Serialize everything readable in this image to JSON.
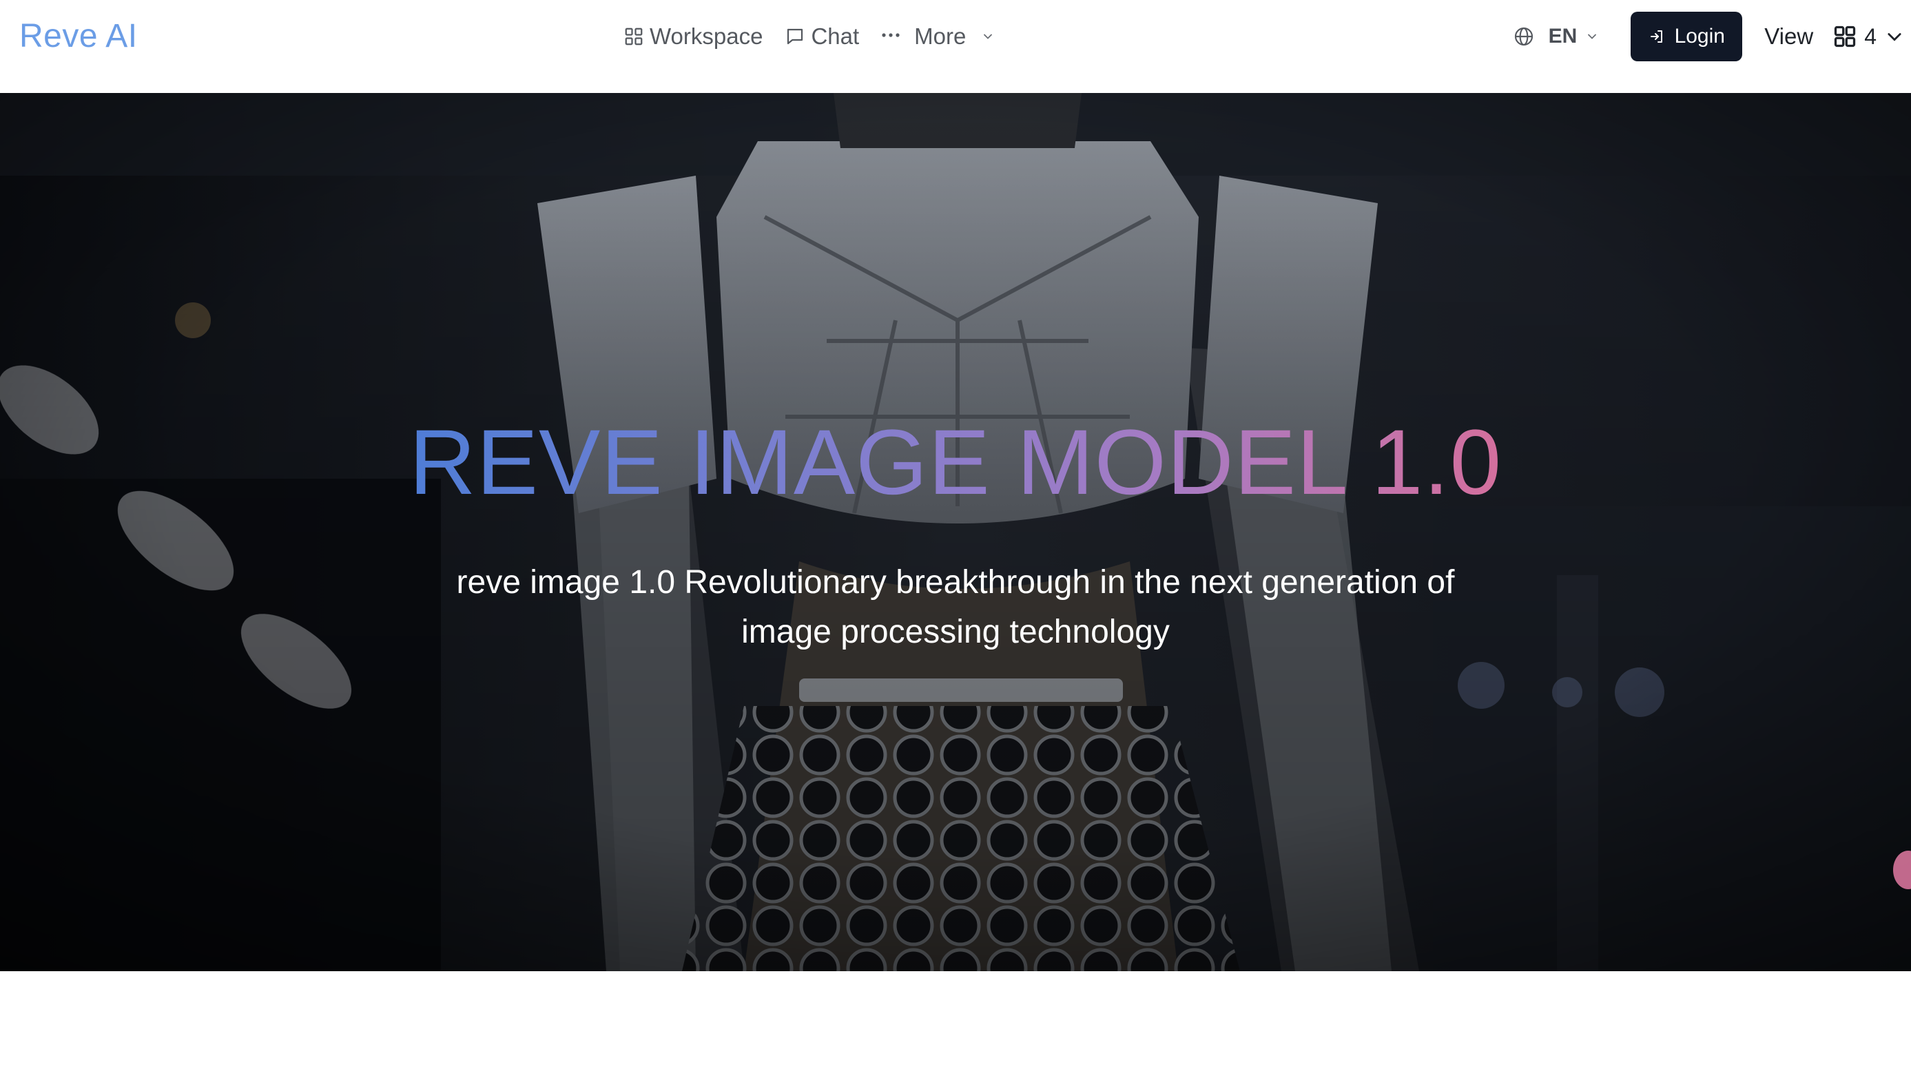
{
  "header": {
    "logo": "Reve AI",
    "nav": [
      {
        "label": "Workspace",
        "icon": "grid-icon"
      },
      {
        "label": "Chat",
        "icon": "chat-bubble-icon"
      },
      {
        "label": "More",
        "icon": "ellipsis-icon"
      }
    ],
    "language": "EN",
    "login_label": "Login",
    "view_label": "View",
    "view_count": "4"
  },
  "hero": {
    "title": "REVE IMAGE MODEL 1.0",
    "subtitle": "reve image 1.0 Revolutionary breakthrough in the next generation of image processing technology",
    "title_gradient": [
      "#4f7dd6",
      "#7b7fd0",
      "#a77bc3",
      "#d46f9d"
    ]
  },
  "colors": {
    "logo": "#6b9de6",
    "login_button": "#111827",
    "nav_text": "#55595f"
  }
}
